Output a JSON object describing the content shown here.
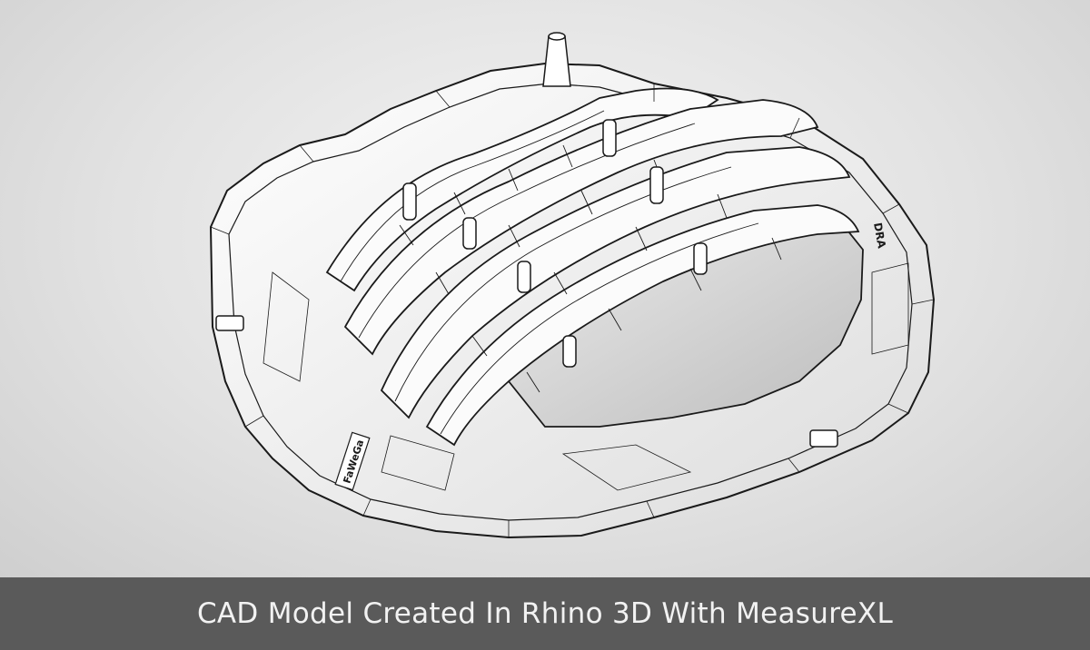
{
  "caption": "CAD Model Created In Rhino 3D With MeasureXL",
  "model": {
    "description_icon": "cad-wireframe-part",
    "stamp_text": "FaWeGa",
    "edge_text": "DRA"
  },
  "colors": {
    "background": "#e2e2e2",
    "caption_bar": "#5a5a5a",
    "caption_text": "#f2f2f2",
    "model_fill": "#f5f5f5",
    "wire": "#1a1a1a"
  }
}
